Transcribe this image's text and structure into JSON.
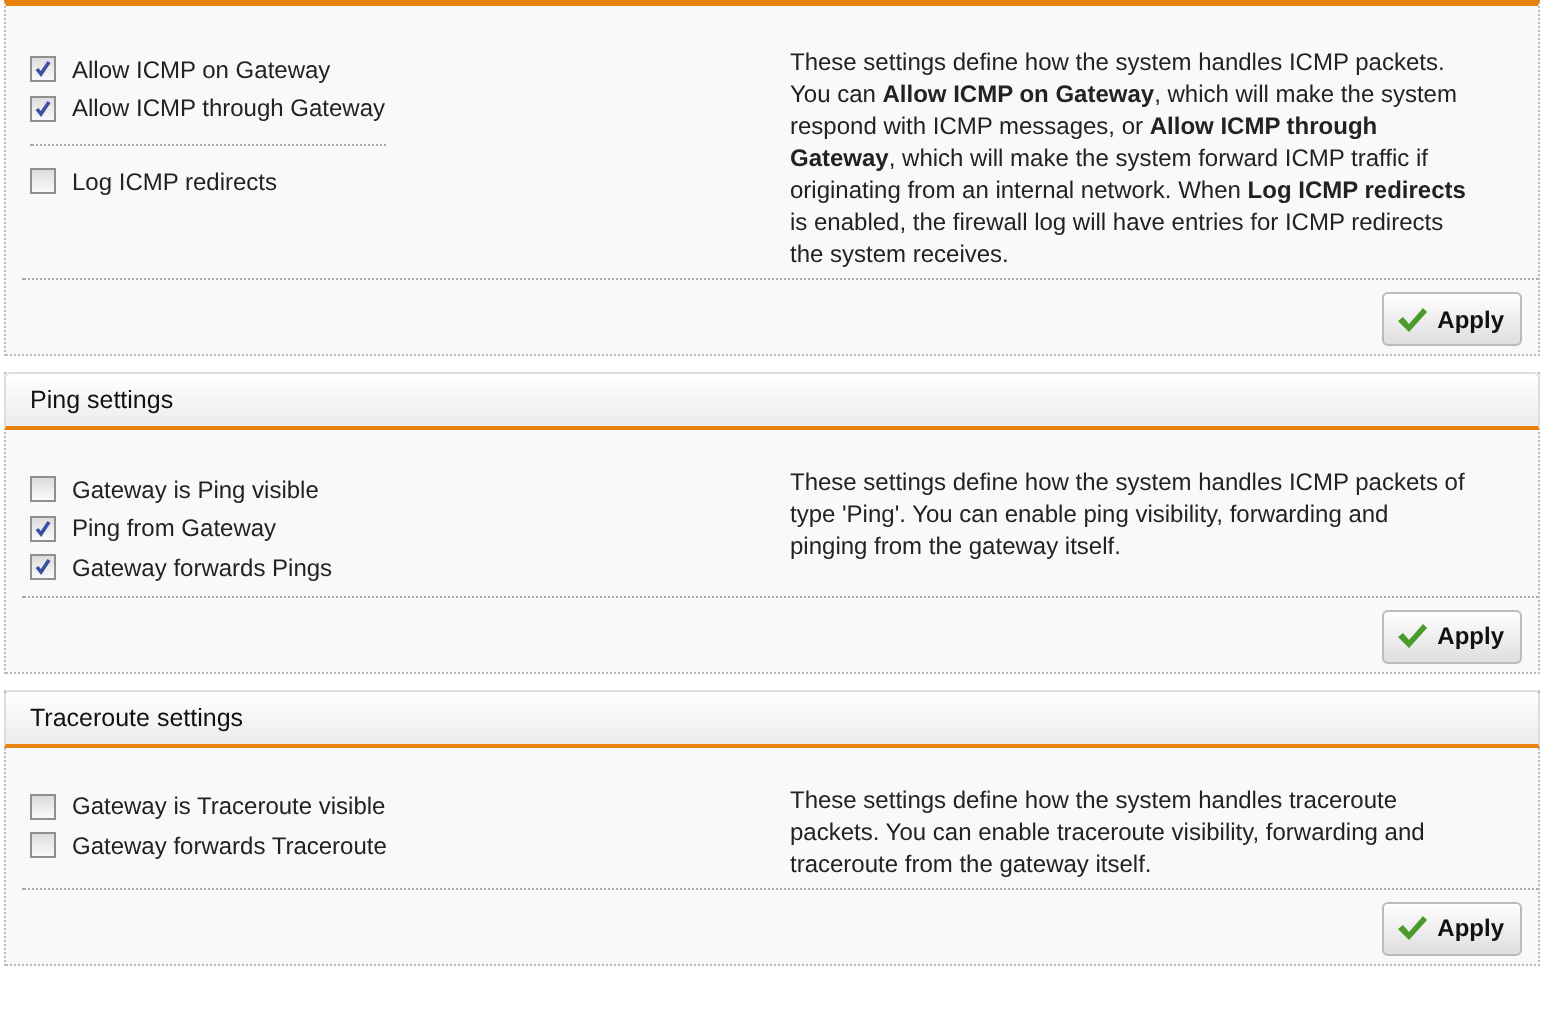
{
  "sections": [
    {
      "groups": [
        [
          {
            "label": "Allow ICMP on Gateway",
            "checked": true
          },
          {
            "label": "Allow ICMP through Gateway",
            "checked": true
          }
        ],
        [
          {
            "label": "Log ICMP redirects",
            "checked": false
          }
        ]
      ],
      "description": "These settings define how the system handles ICMP packets. You can **Allow ICMP on Gateway**, which will make the system respond with ICMP messages, or **Allow ICMP through Gateway**, which will make the system forward ICMP traffic if originating from an internal network. When **Log ICMP redirects** is enabled, the firewall log will have entries for ICMP redirects the system receives.",
      "button": "Apply"
    },
    {
      "title": "Ping settings",
      "groups": [
        [
          {
            "label": "Gateway is Ping visible",
            "checked": false
          },
          {
            "label": "Ping from Gateway",
            "checked": true
          },
          {
            "label": "Gateway forwards Pings",
            "checked": true
          }
        ]
      ],
      "description": "These settings define how the system handles ICMP packets of type 'Ping'. You can enable ping visibility, forwarding and pinging from the gateway itself.",
      "button": "Apply"
    },
    {
      "title": "Traceroute settings",
      "groups": [
        [
          {
            "label": "Gateway is Traceroute visible",
            "checked": false
          },
          {
            "label": "Gateway forwards Traceroute",
            "checked": false
          }
        ]
      ],
      "description": "These settings define how the system handles traceroute packets. You can enable traceroute visibility, forwarding and traceroute from the gateway itself.",
      "button": "Apply"
    }
  ]
}
